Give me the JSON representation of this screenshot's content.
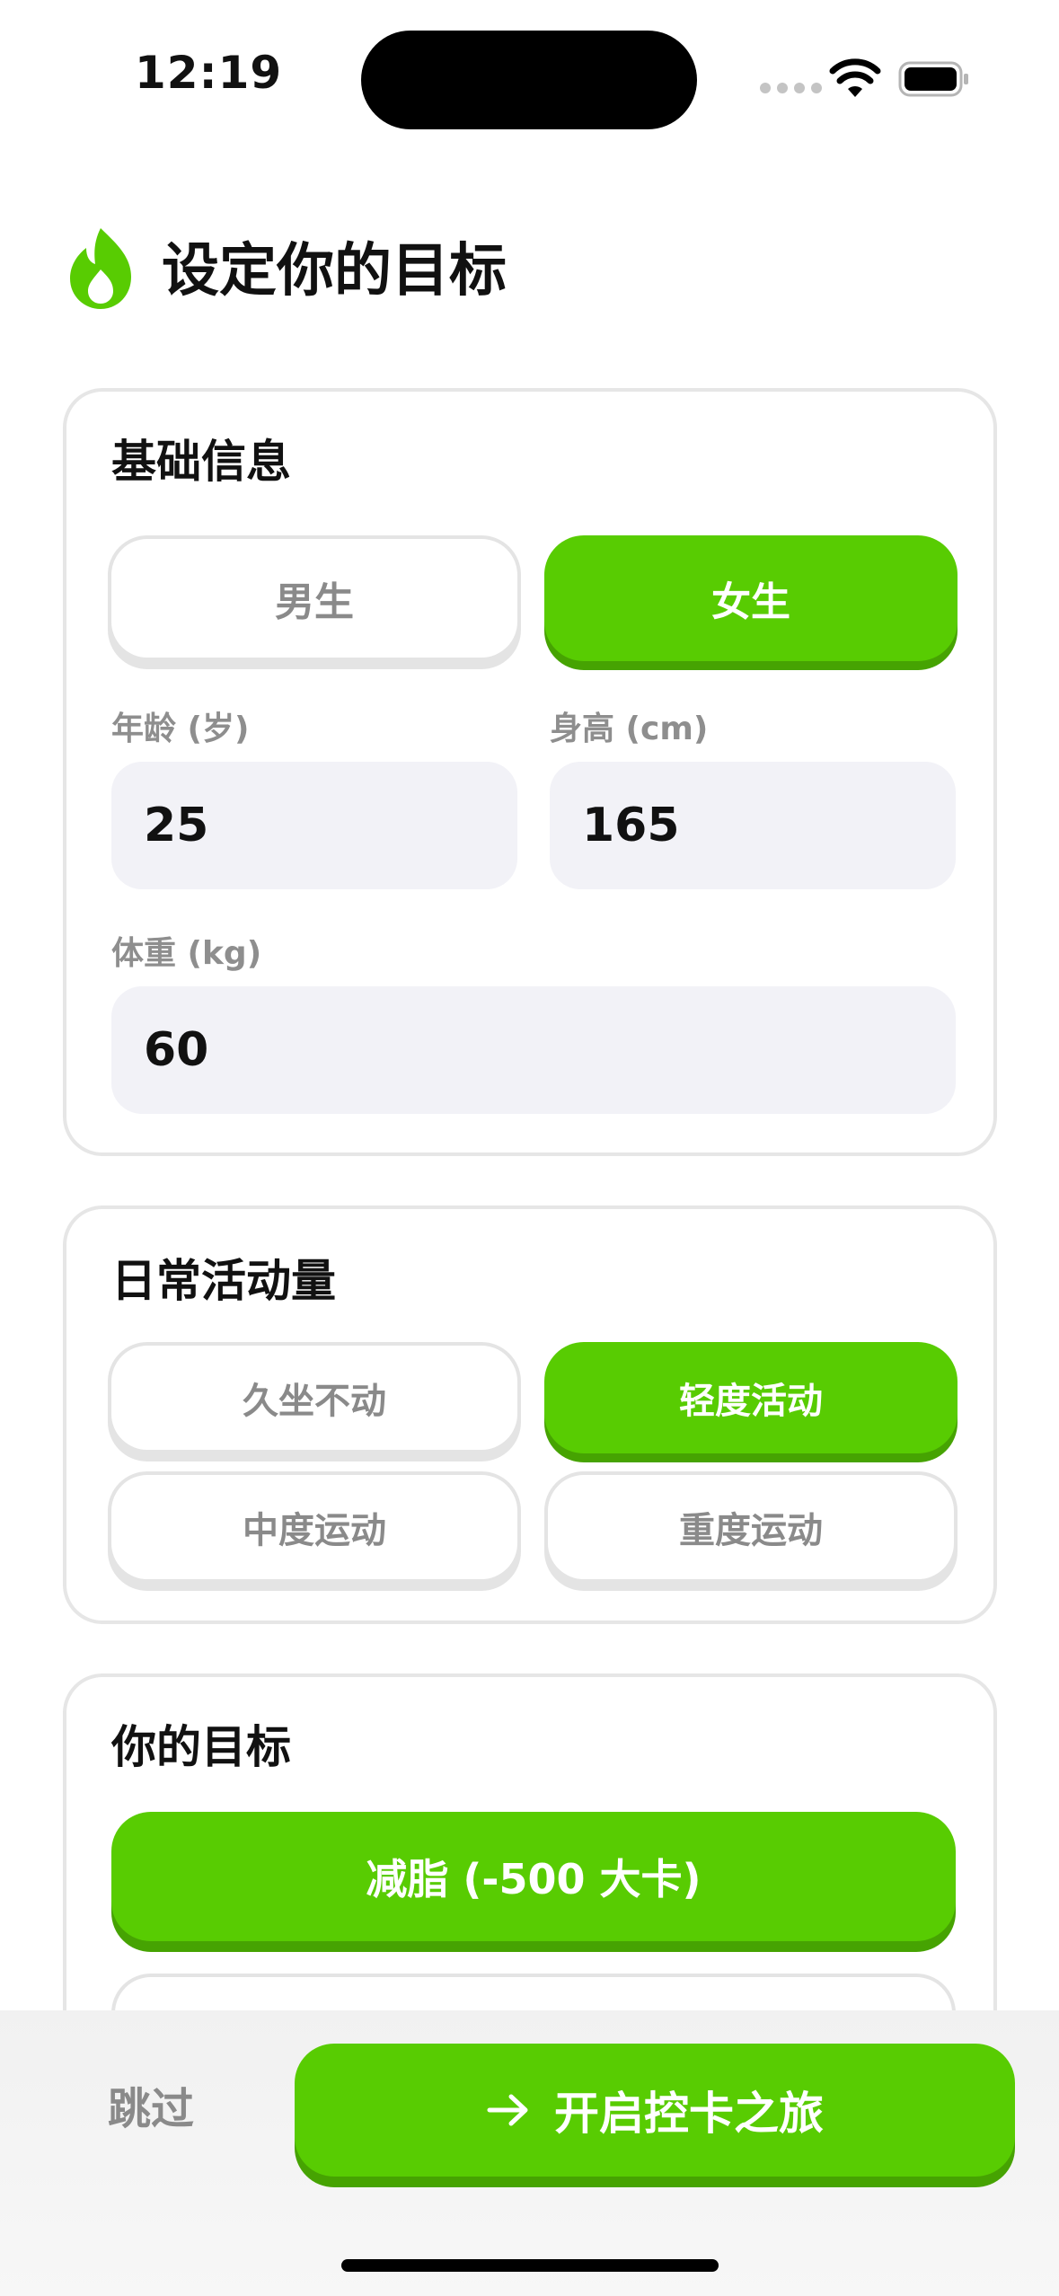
{
  "status_bar": {
    "time": "12:19"
  },
  "header": {
    "title": "设定你的目标",
    "icon": "flame-icon"
  },
  "basic_info": {
    "title": "基础信息",
    "gender_options": [
      "男生",
      "女生"
    ],
    "selected_gender": "女生",
    "age": {
      "label": "年龄 (岁)",
      "value": "25"
    },
    "height": {
      "label": "身高 (cm)",
      "value": "165"
    },
    "weight": {
      "label": "体重 (kg)",
      "value": "60"
    }
  },
  "activity": {
    "title": "日常活动量",
    "options": [
      "久坐不动",
      "轻度活动",
      "中度运动",
      "重度运动"
    ],
    "selected": "轻度活动"
  },
  "goal": {
    "title": "你的目标",
    "options": [
      "减脂 (-500 大卡)"
    ],
    "selected": "减脂 (-500 大卡)"
  },
  "footer": {
    "skip_label": "跳过",
    "start_label": "开启控卡之旅"
  },
  "colors": {
    "accent": "#58cc02",
    "accent_shadow": "#46a302",
    "field_bg": "#f2f2f7",
    "muted_text": "#8a8a8a"
  }
}
